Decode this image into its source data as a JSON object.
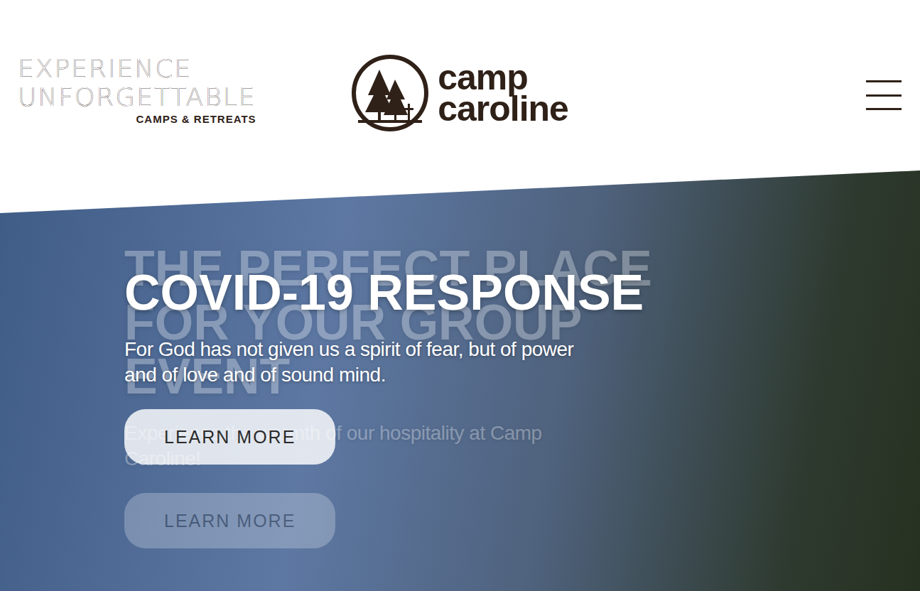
{
  "header": {
    "tagline": [
      "EXPERIENCE",
      "UNFORGETTABLE"
    ],
    "tagline_sub": "CAMPS & RETREATS",
    "logo": [
      "camp",
      "caroline"
    ]
  },
  "slides": [
    {
      "title": "THE PERFECT PLACE FOR YOUR GROUP EVENT",
      "text": "Experience the warmth of our hospitality at Camp Caroline!",
      "button": "LEARN MORE",
      "active": false
    },
    {
      "title": "COVID-19 RESPONSE",
      "text": "For God has not given us a spirit of fear, but of power and of love and of sound mind.",
      "button": "LEARN MORE",
      "active": true
    }
  ]
}
